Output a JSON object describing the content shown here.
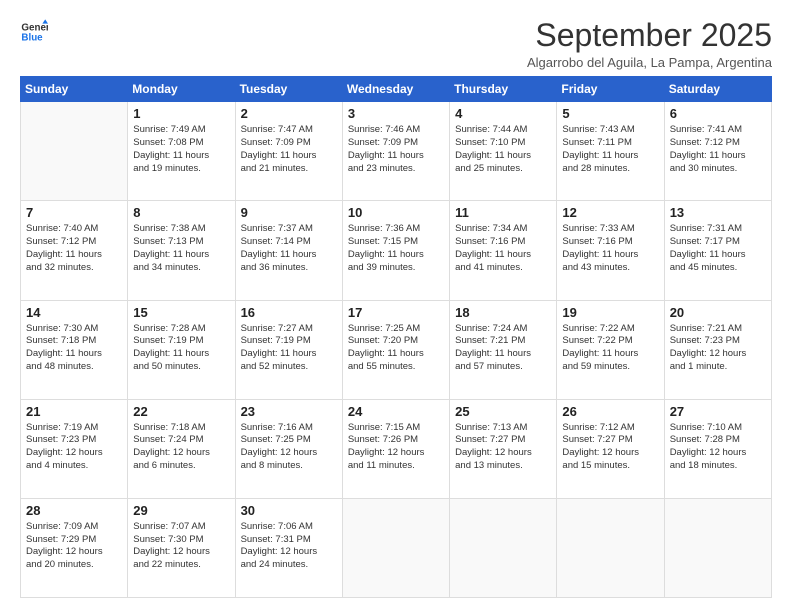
{
  "logo": {
    "line1": "General",
    "line2": "Blue"
  },
  "title": "September 2025",
  "subtitle": "Algarrobo del Aguila, La Pampa, Argentina",
  "days_header": [
    "Sunday",
    "Monday",
    "Tuesday",
    "Wednesday",
    "Thursday",
    "Friday",
    "Saturday"
  ],
  "weeks": [
    [
      {
        "num": "",
        "info": ""
      },
      {
        "num": "1",
        "info": "Sunrise: 7:49 AM\nSunset: 7:08 PM\nDaylight: 11 hours\nand 19 minutes."
      },
      {
        "num": "2",
        "info": "Sunrise: 7:47 AM\nSunset: 7:09 PM\nDaylight: 11 hours\nand 21 minutes."
      },
      {
        "num": "3",
        "info": "Sunrise: 7:46 AM\nSunset: 7:09 PM\nDaylight: 11 hours\nand 23 minutes."
      },
      {
        "num": "4",
        "info": "Sunrise: 7:44 AM\nSunset: 7:10 PM\nDaylight: 11 hours\nand 25 minutes."
      },
      {
        "num": "5",
        "info": "Sunrise: 7:43 AM\nSunset: 7:11 PM\nDaylight: 11 hours\nand 28 minutes."
      },
      {
        "num": "6",
        "info": "Sunrise: 7:41 AM\nSunset: 7:12 PM\nDaylight: 11 hours\nand 30 minutes."
      }
    ],
    [
      {
        "num": "7",
        "info": "Sunrise: 7:40 AM\nSunset: 7:12 PM\nDaylight: 11 hours\nand 32 minutes."
      },
      {
        "num": "8",
        "info": "Sunrise: 7:38 AM\nSunset: 7:13 PM\nDaylight: 11 hours\nand 34 minutes."
      },
      {
        "num": "9",
        "info": "Sunrise: 7:37 AM\nSunset: 7:14 PM\nDaylight: 11 hours\nand 36 minutes."
      },
      {
        "num": "10",
        "info": "Sunrise: 7:36 AM\nSunset: 7:15 PM\nDaylight: 11 hours\nand 39 minutes."
      },
      {
        "num": "11",
        "info": "Sunrise: 7:34 AM\nSunset: 7:16 PM\nDaylight: 11 hours\nand 41 minutes."
      },
      {
        "num": "12",
        "info": "Sunrise: 7:33 AM\nSunset: 7:16 PM\nDaylight: 11 hours\nand 43 minutes."
      },
      {
        "num": "13",
        "info": "Sunrise: 7:31 AM\nSunset: 7:17 PM\nDaylight: 11 hours\nand 45 minutes."
      }
    ],
    [
      {
        "num": "14",
        "info": "Sunrise: 7:30 AM\nSunset: 7:18 PM\nDaylight: 11 hours\nand 48 minutes."
      },
      {
        "num": "15",
        "info": "Sunrise: 7:28 AM\nSunset: 7:19 PM\nDaylight: 11 hours\nand 50 minutes."
      },
      {
        "num": "16",
        "info": "Sunrise: 7:27 AM\nSunset: 7:19 PM\nDaylight: 11 hours\nand 52 minutes."
      },
      {
        "num": "17",
        "info": "Sunrise: 7:25 AM\nSunset: 7:20 PM\nDaylight: 11 hours\nand 55 minutes."
      },
      {
        "num": "18",
        "info": "Sunrise: 7:24 AM\nSunset: 7:21 PM\nDaylight: 11 hours\nand 57 minutes."
      },
      {
        "num": "19",
        "info": "Sunrise: 7:22 AM\nSunset: 7:22 PM\nDaylight: 11 hours\nand 59 minutes."
      },
      {
        "num": "20",
        "info": "Sunrise: 7:21 AM\nSunset: 7:23 PM\nDaylight: 12 hours\nand 1 minute."
      }
    ],
    [
      {
        "num": "21",
        "info": "Sunrise: 7:19 AM\nSunset: 7:23 PM\nDaylight: 12 hours\nand 4 minutes."
      },
      {
        "num": "22",
        "info": "Sunrise: 7:18 AM\nSunset: 7:24 PM\nDaylight: 12 hours\nand 6 minutes."
      },
      {
        "num": "23",
        "info": "Sunrise: 7:16 AM\nSunset: 7:25 PM\nDaylight: 12 hours\nand 8 minutes."
      },
      {
        "num": "24",
        "info": "Sunrise: 7:15 AM\nSunset: 7:26 PM\nDaylight: 12 hours\nand 11 minutes."
      },
      {
        "num": "25",
        "info": "Sunrise: 7:13 AM\nSunset: 7:27 PM\nDaylight: 12 hours\nand 13 minutes."
      },
      {
        "num": "26",
        "info": "Sunrise: 7:12 AM\nSunset: 7:27 PM\nDaylight: 12 hours\nand 15 minutes."
      },
      {
        "num": "27",
        "info": "Sunrise: 7:10 AM\nSunset: 7:28 PM\nDaylight: 12 hours\nand 18 minutes."
      }
    ],
    [
      {
        "num": "28",
        "info": "Sunrise: 7:09 AM\nSunset: 7:29 PM\nDaylight: 12 hours\nand 20 minutes."
      },
      {
        "num": "29",
        "info": "Sunrise: 7:07 AM\nSunset: 7:30 PM\nDaylight: 12 hours\nand 22 minutes."
      },
      {
        "num": "30",
        "info": "Sunrise: 7:06 AM\nSunset: 7:31 PM\nDaylight: 12 hours\nand 24 minutes."
      },
      {
        "num": "",
        "info": ""
      },
      {
        "num": "",
        "info": ""
      },
      {
        "num": "",
        "info": ""
      },
      {
        "num": "",
        "info": ""
      }
    ]
  ]
}
